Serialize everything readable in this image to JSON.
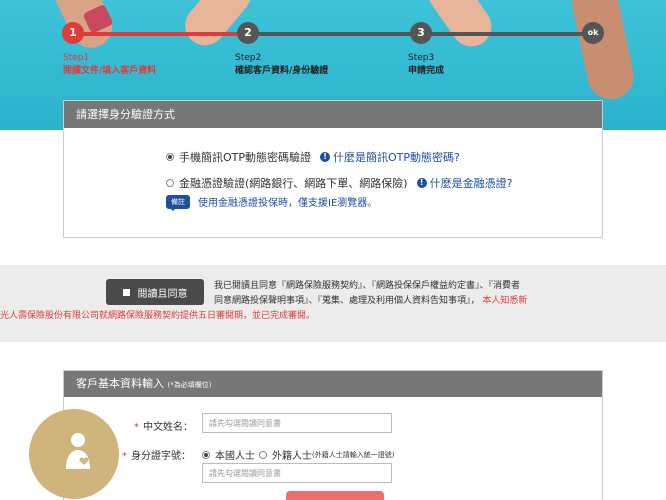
{
  "steps": [
    {
      "num": "1",
      "label_n": "Step1",
      "label_t": "閱讀文件/填入客戶資料",
      "state": "active"
    },
    {
      "num": "2",
      "label_n": "Step2",
      "label_t": "確認客戶資料/身份驗證",
      "state": "inactive"
    },
    {
      "num": "3",
      "label_n": "Step3",
      "label_t": "申請完成",
      "state": "inactive"
    },
    {
      "num": "ok",
      "label_n": "",
      "label_t": "",
      "state": "inactive"
    }
  ],
  "identity": {
    "title": "請選擇身分驗證方式",
    "option1": "手機簡訊OTP動態密碼驗證",
    "option1_link": "什麼是簡訊OTP動態密碼?",
    "option2": "金融憑證驗證(網路銀行、網路下單、網路保險)",
    "option2_link": "什麼是金融憑證?",
    "note_badge": "備註",
    "note_text": "使用金融憑證投保時，僅支援IE瀏覽器。"
  },
  "agreement": {
    "button": "閱讀且同意",
    "line1": "我已閱讀且同意『網路保險服務契約』、『網路投保保戶權益約定書』、『消費者",
    "line2": "同意網路投保聲明事項』、『蒐集、處理及利用個人資料告知事項』，",
    "line2_red": "本人知悉新",
    "line3_red": "光人壽保險股份有限公司就網路保險服務契約提供五日審閱期，並已完成審閱。"
  },
  "customer": {
    "title": "客戶基本資料輸入",
    "required_note": "(*為必填欄位)",
    "name_label": "中文姓名：",
    "name_placeholder": "請先勾選閱讀同意書",
    "id_label": "身分證字號：",
    "id_option1": "本國人士",
    "id_option2": "外籍人士",
    "id_option2_note": "(外籍人士請輸入統一證號)",
    "id_placeholder": "請先勾選閱讀同意書"
  },
  "colors": {
    "accent_red": "#e03b3b",
    "link_blue": "#1d4fa0",
    "header_gray": "#777777",
    "hero_cyan": "#3ec3d8"
  }
}
